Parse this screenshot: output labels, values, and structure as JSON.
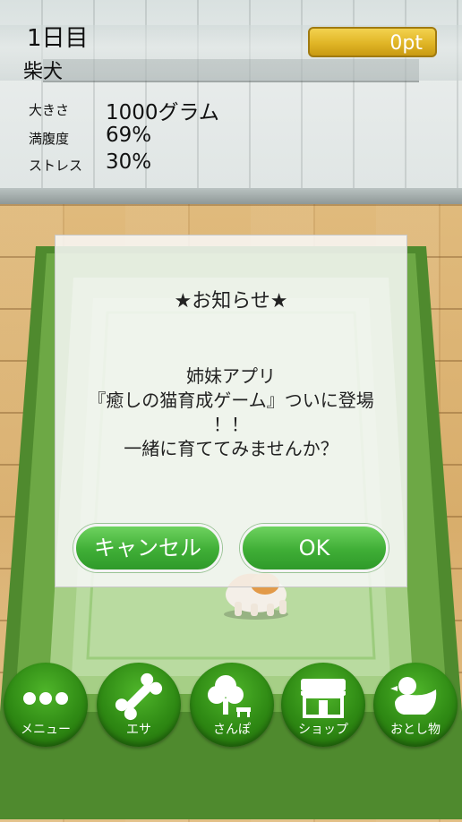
{
  "status": {
    "day": "1日目",
    "breed": "柴犬",
    "points": "0pt",
    "stats": [
      {
        "label": "大きさ",
        "value": "1000グラム"
      },
      {
        "label": "満腹度",
        "value": "69%"
      },
      {
        "label": "ストレス",
        "value": "30%"
      }
    ]
  },
  "dialog": {
    "title": "★お知らせ★",
    "lines": [
      "姉妹アプリ",
      "『癒しの猫育成ゲーム』ついに登場",
      "！！",
      "一緒に育ててみませんか？"
    ],
    "cancel_label": "キャンセル",
    "ok_label": "OK"
  },
  "nav": [
    {
      "label": "メニュー",
      "icon": "dots-icon"
    },
    {
      "label": "エサ",
      "icon": "bone-icon"
    },
    {
      "label": "さんぽ",
      "icon": "tree-icon"
    },
    {
      "label": "ショップ",
      "icon": "shop-icon"
    },
    {
      "label": "おとし物",
      "icon": "duck-icon"
    }
  ],
  "colors": {
    "accent_green": "#3fae36",
    "points_gold": "#e0b526"
  }
}
